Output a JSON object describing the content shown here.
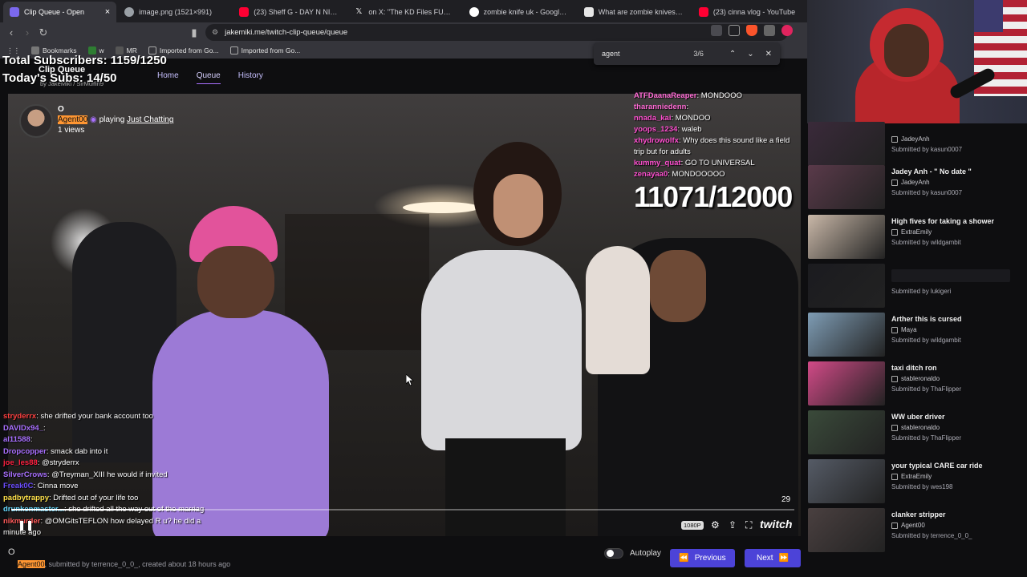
{
  "browser": {
    "tabs": [
      {
        "title": "Clip Queue - Open",
        "color": "#7b68ee",
        "active": true
      },
      {
        "title": "image.png (1521×991)",
        "color": "#9aa0a6",
        "active": false
      },
      {
        "title": "(23) Sheff G - DAY N NITE Free",
        "color": "#ff0033",
        "active": false
      },
      {
        "title": "on X: \"The KD Files FULL T",
        "color": "#e6e6e6",
        "active": false
      },
      {
        "title": "zombie knife uk - Google Sear",
        "color": "#4285f4",
        "active": false
      },
      {
        "title": "What are zombie knives – and",
        "color": "#e6e6e6",
        "active": false
      },
      {
        "title": "(23) cinna vlog - YouTube",
        "color": "#ff0033",
        "active": false
      }
    ],
    "url": "jakemiki.me/twitch-clip-queue/queue",
    "bookmarks": [
      "Bookmarks",
      "w",
      "MR",
      "Imported from Go...",
      "Imported from Go..."
    ],
    "find": {
      "query": "agent",
      "count": "3/6"
    }
  },
  "overlay": {
    "total_subs": "Total Subscribers: 1159/1250",
    "today_subs": "Today's Subs: 14/50"
  },
  "app": {
    "brand": "Clip Queue",
    "brand_sub": "by JakeMiki / SirMuffin9",
    "nav": {
      "home": "Home",
      "queue": "Queue",
      "history": "History"
    }
  },
  "video": {
    "title": "O",
    "author": "Agent00",
    "playing": "playing",
    "category": "Just Chatting",
    "views": "1 views",
    "counter": "11071/12000",
    "timer": "29",
    "quality": "1080P",
    "progress": 0.24,
    "twitch": "twitch"
  },
  "chat_top": [
    {
      "name": "ATFDaanaReaper",
      "msg": "MONDOOO",
      "color": "#ff6bd5"
    },
    {
      "name": "tharanniedenn",
      "msg": "",
      "color": "#ff6bd5"
    },
    {
      "name": "nnada_kai",
      "msg": "MONDOO",
      "color": "#ff4fd0"
    },
    {
      "name": "yoops_1234",
      "msg": "waleb",
      "color": "#ff4fd0"
    },
    {
      "name": "xhydrowolfx",
      "msg": "Why does this sound like a field trip but for adults",
      "color": "#ff4fd0"
    },
    {
      "name": "kummy_quat",
      "msg": "GO TO UNIVERSAL",
      "color": "#ff4fd0"
    },
    {
      "name": "zenayaa0",
      "msg": "MONDOOOOO",
      "color": "#ff4fd0"
    }
  ],
  "chat_bottom": [
    {
      "name": "stryderrx",
      "msg": "she drifted your bank account too",
      "color": "#ff4040"
    },
    {
      "name": "DAVIDx94_",
      "msg": "",
      "color": "#a970ff"
    },
    {
      "name": "al11588",
      "msg": "",
      "color": "#a970ff"
    },
    {
      "name": "Dropcopper",
      "msg": "smack dab into it",
      "color": "#a970ff"
    },
    {
      "name": "joe_les88",
      "msg": "@stryderrx",
      "color": "#ff2040"
    },
    {
      "name": "SilverCrows",
      "msg": "@Treyman_XIII he would if invited",
      "color": "#a970ff"
    },
    {
      "name": "Freak0C",
      "msg": "Cinna move",
      "color": "#6b4cff"
    },
    {
      "name": "padbytrappy",
      "msg": "Drifted out of your life too",
      "color": "#ffe14a"
    },
    {
      "name": "drunkenmaster...",
      "msg": "she drifted all the way out of the marriag",
      "color": "#66d9ff"
    },
    {
      "name": "nikmurder",
      "msg": "@OMGitsTEFLON how delayed R u? he did a minute ago",
      "color": "#ff5a5a"
    }
  ],
  "footer": {
    "zero": "O",
    "meta_user": "Agent00",
    "meta_rest": ", submitted by terrence_0_0_, created about 18 hours ago",
    "autoplay": "Autoplay",
    "prev": "Previous",
    "next": "Next"
  },
  "queue": [
    {
      "title": "",
      "channel": "JadeyAnh",
      "submitter": "Submitted by kasun0007",
      "thumb": "#3a2a3a",
      "blank_title": false
    },
    {
      "title": "Jadey Anh - \" No date \"",
      "channel": "JadeyAnh",
      "submitter": "Submitted by kasun0007",
      "thumb": "#5a3a4a",
      "blank_title": false
    },
    {
      "title": "High fives for taking a shower",
      "channel": "ExtraEmily",
      "submitter": "Submitted by wildgambit",
      "thumb": "#c9b8a8",
      "blank_title": false
    },
    {
      "title": "",
      "channel": "",
      "submitter": "Submitted by lukigeri",
      "thumb": "#1b1b1f",
      "blank_title": true
    },
    {
      "title": "Arther this is cursed",
      "channel": "Maya",
      "submitter": "Submitted by wildgambit",
      "thumb": "#7e9cb4",
      "blank_title": false
    },
    {
      "title": "taxi ditch ron",
      "channel": "stableronaldo",
      "submitter": "Submitted by ThaFlipper",
      "thumb": "#d14a87",
      "blank_title": false
    },
    {
      "title": "WW uber driver",
      "channel": "stableronaldo",
      "submitter": "Submitted by ThaFlipper",
      "thumb": "#3a4a3a",
      "blank_title": false
    },
    {
      "title": "your typical CARE car ride",
      "channel": "ExtraEmily",
      "submitter": "Submitted by wes198",
      "thumb": "#555b66",
      "blank_title": false
    },
    {
      "title": "clanker stripper",
      "channel": "Agent00",
      "submitter": "Submitted by terrence_0_0_",
      "thumb": "#4a4040",
      "blank_title": false
    }
  ],
  "colors": {
    "accent": "#4c43d8",
    "nav_link": "#c7c0ff",
    "find_highlight": "#ff9632"
  }
}
